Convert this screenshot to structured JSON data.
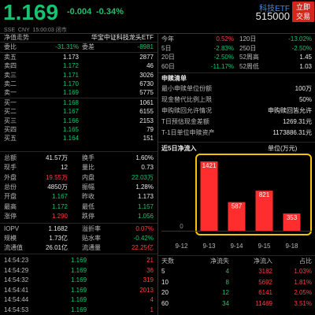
{
  "header": {
    "price": "1.169",
    "change": "-0.004",
    "change_pct": "-0.34%",
    "name": "科技ETF",
    "code": "515000",
    "trade_button": "立即\n交易",
    "market": "SSE",
    "currency": "CNY",
    "time": "15:00:03",
    "status": "闭市"
  },
  "fund_bar": {
    "left": "净值走势",
    "right": "华宝中证科技龙头ETF"
  },
  "weibi": {
    "l1": "委比",
    "v1": "-31.31%",
    "l2": "委差",
    "v2": "-8981"
  },
  "order_book": {
    "sell": [
      {
        "label": "卖五",
        "price": "1.173",
        "vol": "2877"
      },
      {
        "label": "卖四",
        "price": "1.172",
        "vol": "46"
      },
      {
        "label": "卖三",
        "price": "1.171",
        "vol": "3026"
      },
      {
        "label": "卖二",
        "price": "1.170",
        "vol": "6730"
      },
      {
        "label": "卖一",
        "price": "1.169",
        "vol": "5775"
      }
    ],
    "buy": [
      {
        "label": "买一",
        "price": "1.168",
        "vol": "1061"
      },
      {
        "label": "买二",
        "price": "1.167",
        "vol": "6155"
      },
      {
        "label": "买三",
        "price": "1.166",
        "vol": "2153"
      },
      {
        "label": "买四",
        "price": "1.165",
        "vol": "79"
      },
      {
        "label": "买五",
        "price": "1.164",
        "vol": "151"
      }
    ]
  },
  "stats": [
    {
      "l1": "总额",
      "v1": "41.57万",
      "l2": "换手",
      "v2": "1.60%"
    },
    {
      "l1": "现手",
      "v1": "12",
      "l2": "量比",
      "v2": "0.73"
    },
    {
      "l1": "外盘",
      "v1": "19.55万",
      "l2": "内盘",
      "v2": "22.03万"
    },
    {
      "l1": "总份",
      "v1": "4850万",
      "l2": "振幅",
      "v2": "1.28%"
    },
    {
      "l1": "开盘",
      "v1": "1.167",
      "l2": "昨收",
      "v2": "1.173"
    },
    {
      "l1": "最高",
      "v1": "1.172",
      "l2": "最低",
      "v2": "1.157"
    },
    {
      "l1": "涨停",
      "v1": "1.290",
      "l2": "跌停",
      "v2": "1.056"
    }
  ],
  "iopv": [
    {
      "l1": "IOPV",
      "v1": "1.1682",
      "l2": "溢折率",
      "v2": "0.07%"
    },
    {
      "l1": "规模",
      "v1": "1.73亿",
      "l2": "贴水率",
      "v2": "-0.42%"
    },
    {
      "l1": "流通值",
      "v1": "26.01亿",
      "l2": "流通量",
      "v2": "22.25亿"
    }
  ],
  "trades": [
    {
      "time": "14:54:23",
      "price": "1.169",
      "vol": "21"
    },
    {
      "time": "14:54:29",
      "price": "1.169",
      "vol": "36"
    },
    {
      "time": "14:54:32",
      "price": "1.169",
      "vol": "319"
    },
    {
      "time": "14:54:41",
      "price": "1.169",
      "vol": "2013"
    },
    {
      "time": "14:54:44",
      "price": "1.169",
      "vol": "4"
    },
    {
      "time": "14:54:53",
      "price": "1.169",
      "vol": "1"
    }
  ],
  "perf": [
    {
      "l1": "今年",
      "v1": "0.52%",
      "l2": "120日",
      "v2": "-13.02%"
    },
    {
      "l1": "5日",
      "v1": "-2.83%",
      "l2": "250日",
      "v2": "-2.50%"
    },
    {
      "l1": "20日",
      "v1": "-2.50%",
      "l2": "52周高",
      "v2": "1.45"
    },
    {
      "l1": "60日",
      "v1": "-11.17%",
      "l2": "52周低",
      "v2": "1.03"
    }
  ],
  "subscription": {
    "title": "申赎清单",
    "rows": [
      {
        "label": "最小申赎单位份额",
        "value": "100万"
      },
      {
        "label": "现金替代比例上限",
        "value": "50%"
      },
      {
        "label": "申购赎回允许情况",
        "value": "申购赎回皆允许"
      },
      {
        "label": "T日预估现金差额",
        "value": "1269.31元"
      },
      {
        "label": "T-1日单位申赎资产",
        "value": "1173886.31元"
      }
    ]
  },
  "inflow_chart": {
    "title": "近5日净流入",
    "unit": "单位(万元)"
  },
  "chart_data": {
    "type": "bar",
    "title": "近5日净流入",
    "unit_label": "单位(万元)",
    "categories": [
      "9-12",
      "9-13",
      "9-14",
      "9-15",
      "9-18"
    ],
    "values": [
      0,
      1421,
      587,
      821,
      353
    ],
    "bar_color": "#ff2d2d",
    "ylim": [
      0,
      1421
    ]
  },
  "flow_table": {
    "headers": [
      "天数",
      "净流失",
      "净流入",
      "占比"
    ],
    "rows": [
      [
        "5",
        "4",
        "3182",
        "1.03%"
      ],
      [
        "10",
        "8",
        "5692",
        "1.81%"
      ],
      [
        "20",
        "12",
        "6141",
        "2.05%"
      ],
      [
        "60",
        "34",
        "11469",
        "3.51%"
      ]
    ]
  },
  "colors": {
    "up": "#ff3c3c",
    "down": "#19c26e",
    "highlight_box": "#f5c400",
    "trade_button": "#d6261c"
  }
}
